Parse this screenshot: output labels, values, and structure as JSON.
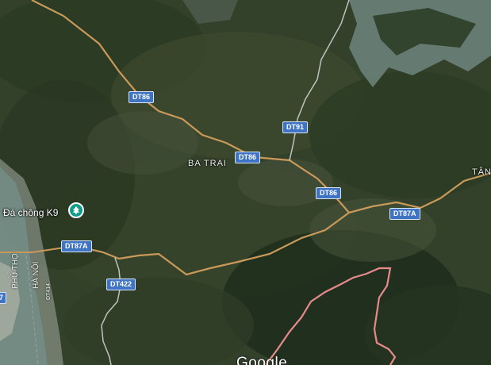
{
  "map": {
    "view": "satellite",
    "colors": {
      "road_main": "#c9995a",
      "road_secondary": "#d9d9d9",
      "shield": "#3f74c4",
      "boundary": "#e88a8a",
      "river": "#7f9a93",
      "poi": "#0f9d8a"
    }
  },
  "places": {
    "ba_trai": "BA TRẠI",
    "tan_partial": "TÂN"
  },
  "roads": {
    "dt86_a": "DT86",
    "dt86_b": "DT86",
    "dt86_c": "DT86",
    "dt91": "DT91",
    "dt87a_a": "DT87A",
    "dt87a_b": "DT87A",
    "dt422": "DT422",
    "dt414": "ĐT414",
    "edge_partial": "7"
  },
  "poi": {
    "name": "Đá chông K9",
    "icon": "park-icon"
  },
  "boundary_labels": {
    "phu_tho": "PHÚ THỌ",
    "ha_noi": "HÀ NỘI"
  },
  "footer": {
    "logo": "Google"
  }
}
